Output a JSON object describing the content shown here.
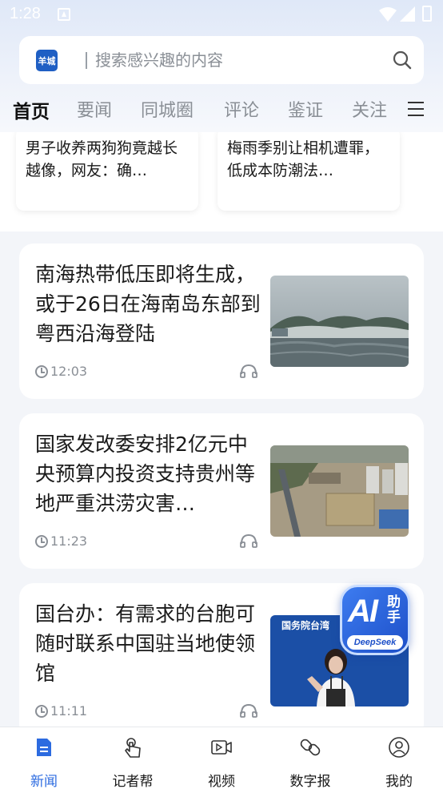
{
  "status_bar": {
    "time": "1:28"
  },
  "search": {
    "placeholder": "搜索感兴趣的内容",
    "logo_text": "羊城"
  },
  "tabs": [
    {
      "label": "首页",
      "active": true
    },
    {
      "label": "要闻"
    },
    {
      "label": "同城圈"
    },
    {
      "label": "评论"
    },
    {
      "label": "鉴证"
    },
    {
      "label": "关注"
    }
  ],
  "top_cards": [
    {
      "title": "男子收养两狗狗竟越长越像，网友：确…"
    },
    {
      "title": "梅雨季别让相机遭罪，低成本防潮法…"
    }
  ],
  "news": [
    {
      "title": "南海热带低压即将生成，或于26日在海南岛东部到粤西沿海登陆",
      "time": "12:03",
      "thumb": "storm-sea-photo"
    },
    {
      "title": "国家发改委安排2亿元中央预算内投资支持贵州等地严重洪涝灾害…",
      "time": "11:23",
      "thumb": "flood-aerial-photo"
    },
    {
      "title": "国台办：有需求的台胞可随时联系中国驻当地使领馆",
      "time": "11:11",
      "thumb": "press-conference-photo",
      "thumb_caption": "国务院台湾"
    }
  ],
  "ai_badge": {
    "main": "AI",
    "side": "助手",
    "sub": "DeepSeek"
  },
  "bottom_nav": [
    {
      "label": "新闻",
      "icon": "news-doc-icon",
      "active": true
    },
    {
      "label": "记者帮",
      "icon": "hand-tap-icon"
    },
    {
      "label": "视频",
      "icon": "video-icon"
    },
    {
      "label": "数字报",
      "icon": "link-icon"
    },
    {
      "label": "我的",
      "icon": "user-icon"
    }
  ],
  "colors": {
    "accent": "#2c6be0",
    "brand": "#1f5fc4"
  }
}
